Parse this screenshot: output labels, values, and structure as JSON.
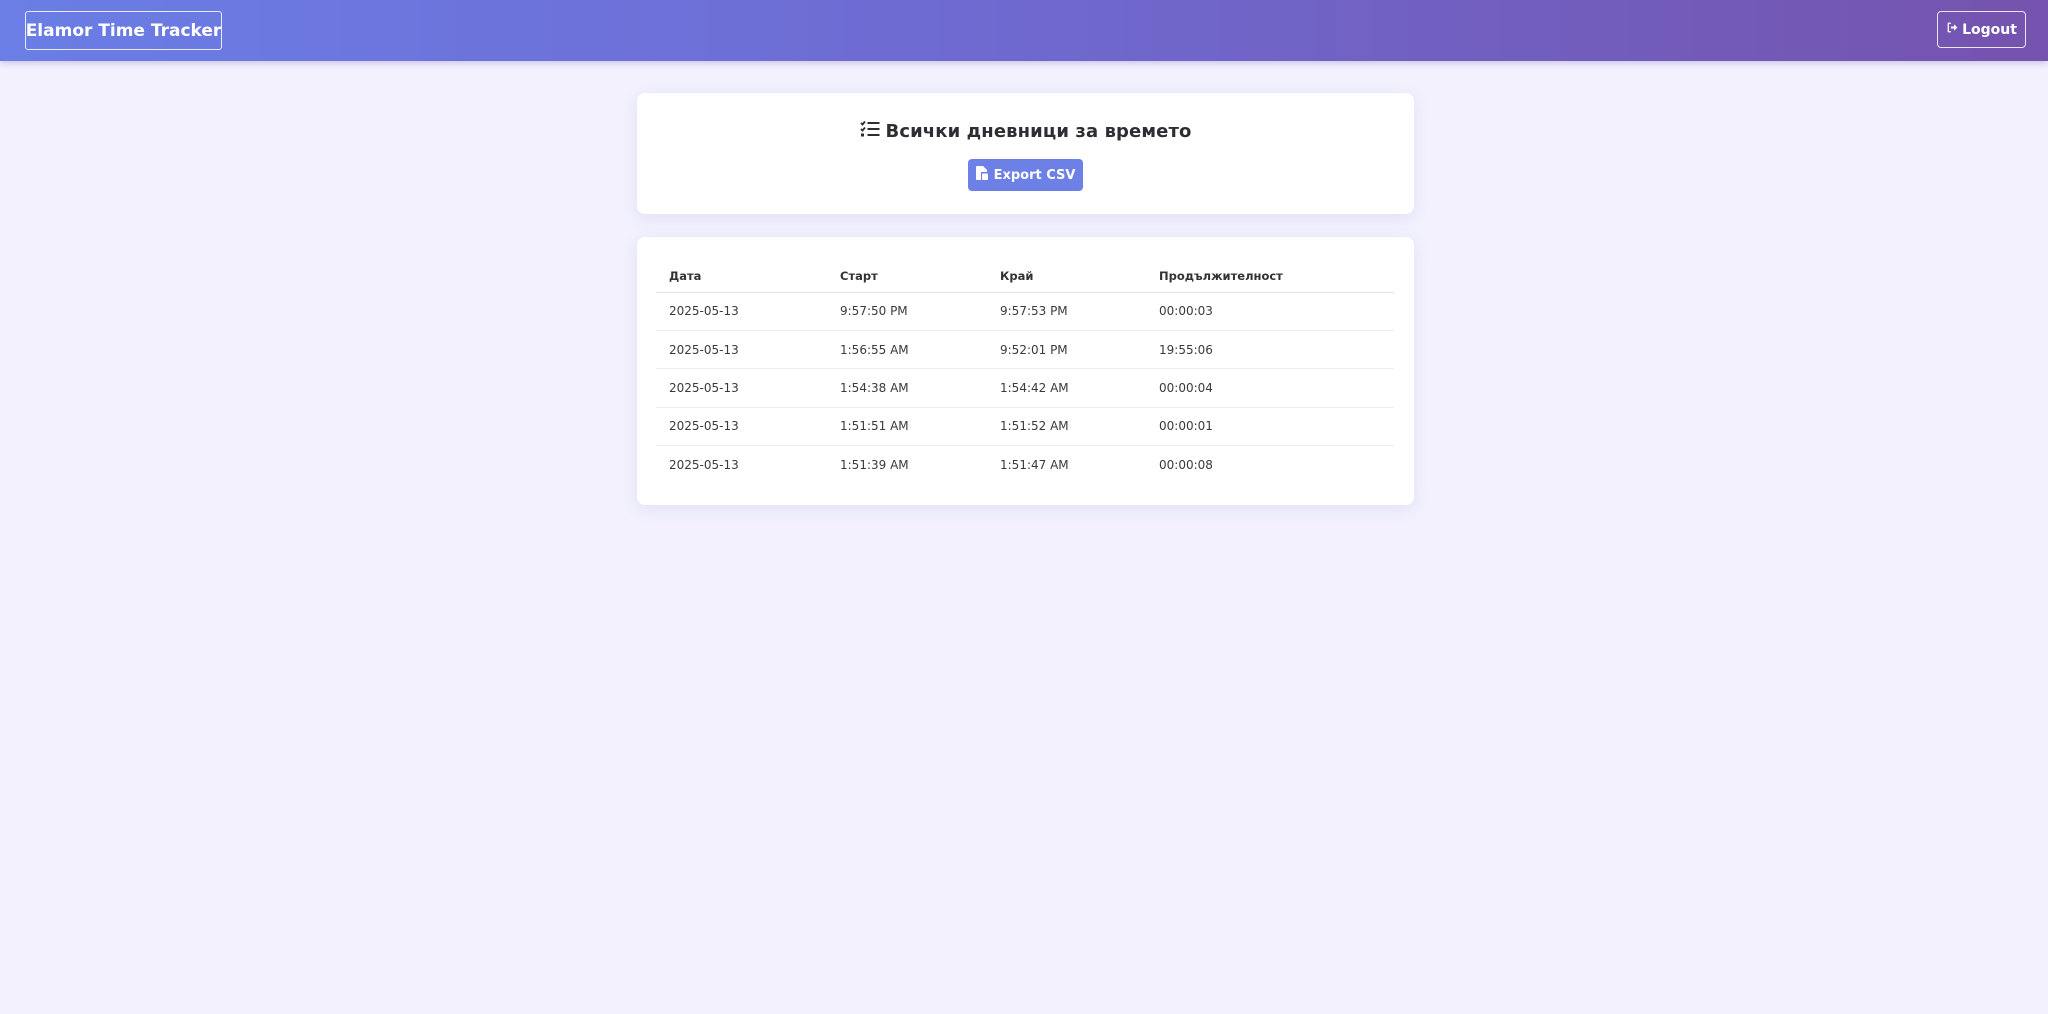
{
  "navbar": {
    "brand": "Elamor Time Tracker",
    "logout_label": "Logout",
    "logout_icon": "sign-out-icon"
  },
  "header_card": {
    "title": "Всички дневници за времето",
    "title_icon": "list-check-icon",
    "export_label": "Export CSV",
    "export_icon": "file-csv-icon"
  },
  "table": {
    "columns": [
      "Дата",
      "Старт",
      "Край",
      "Продължителност"
    ],
    "rows": [
      [
        "2025-05-13",
        "9:57:50 PM",
        "9:57:53 PM",
        "00:00:03"
      ],
      [
        "2025-05-13",
        "1:56:55 AM",
        "9:52:01 PM",
        "19:55:06"
      ],
      [
        "2025-05-13",
        "1:54:38 AM",
        "1:54:42 AM",
        "00:00:04"
      ],
      [
        "2025-05-13",
        "1:51:51 AM",
        "1:51:52 AM",
        "00:00:01"
      ],
      [
        "2025-05-13",
        "1:51:39 AM",
        "1:51:47 AM",
        "00:00:08"
      ]
    ]
  },
  "colors": {
    "accent": "#6d80e6",
    "navbar_start": "#6a7ee6",
    "navbar_end": "#7553ae",
    "background": "#f2f1fd"
  }
}
